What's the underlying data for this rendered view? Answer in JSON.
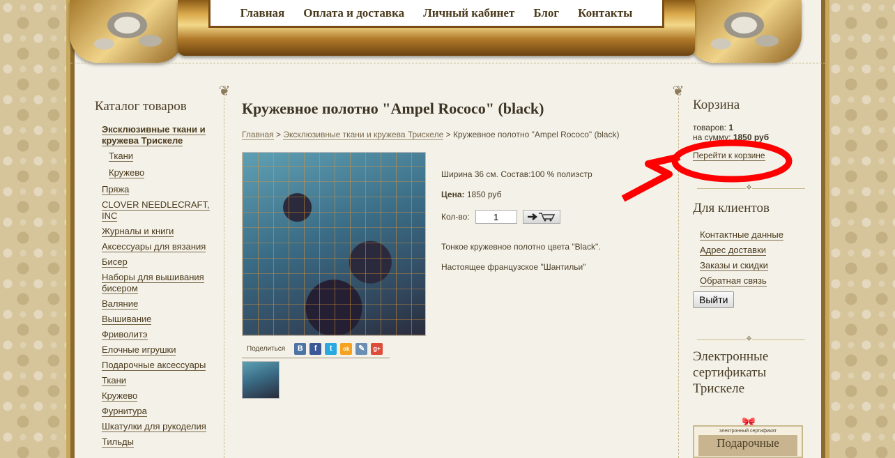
{
  "nav": [
    "Главная",
    "Оплата и доставка",
    "Личный кабинет",
    "Блог",
    "Контакты"
  ],
  "catalog": {
    "title": "Каталог товаров",
    "top": "Эксклюзивные ткани и кружева Трискеле",
    "subs": [
      "Ткани",
      "Кружево"
    ],
    "items": [
      "Пряжа",
      "CLOVER NEEDLECRAFT, INC",
      "Журналы и книги",
      "Аксессуары для вязания",
      "Бисер",
      "Наборы для вышивания бисером",
      "Валяние",
      "Вышивание",
      "Фриволитэ",
      "Елочные игрушки",
      "Подарочные аксессуары",
      "Ткани",
      "Кружево",
      "Фурнитура",
      "Шкатулки для рукоделия",
      "Тильды"
    ]
  },
  "product": {
    "title": "Кружевное полотно \"Ampel Rococo\" (black)",
    "breadcrumb": {
      "home": "Главная",
      "sep": " > ",
      "category": "Эксклюзивные ткани и кружева Трискеле",
      "current": "Кружевное полотно \"Ampel Rococo\" (black)"
    },
    "spec": "Ширина 36 см. Состав:100 % полиэстр",
    "price_label": "Цена:",
    "price": "1850 руб",
    "qty_label": "Кол-во:",
    "qty_value": "1",
    "desc1": "Тонкое кружевное полотно  цвета \"Black\".",
    "desc2": "Настоящее французское \"Шантильи\"",
    "share_label": "Поделиться",
    "share_icons": [
      {
        "name": "vk-icon",
        "glyph": "В",
        "color": "#4c75a3"
      },
      {
        "name": "facebook-icon",
        "glyph": "f",
        "color": "#3b5998"
      },
      {
        "name": "twitter-icon",
        "glyph": "t",
        "color": "#2aa9e0"
      },
      {
        "name": "odnoklassniki-icon",
        "glyph": "ok",
        "color": "#f4a21f"
      },
      {
        "name": "livejournal-icon",
        "glyph": "✎",
        "color": "#6b8fb3"
      },
      {
        "name": "googleplus-icon",
        "glyph": "g+",
        "color": "#dd4b39"
      }
    ]
  },
  "cart": {
    "title": "Корзина",
    "items_label": "товаров:",
    "items_count": "1",
    "sum_label": "на сумму:",
    "sum": "1850 руб",
    "link": "Перейти к корзине"
  },
  "clients": {
    "title": "Для клиентов",
    "links": [
      "Контактные данные",
      "Адрес доставки",
      "Заказы и скидки",
      "Обратная связь"
    ],
    "logout": "Выйти"
  },
  "certificates": {
    "title": "Электронные сертификаты Трискеле",
    "card_top": "электронный сертификат",
    "card_main": "Подарочные"
  },
  "colors": {
    "annotation": "#ff0000",
    "accent_gold": "#c9a85c"
  }
}
